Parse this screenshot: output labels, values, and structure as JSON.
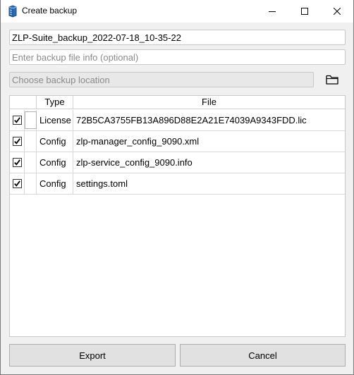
{
  "window": {
    "title": "Create backup",
    "icon": "database-icon"
  },
  "form": {
    "backup_name_value": "ZLP-Suite_backup_2022-07-18_10-35-22",
    "info_placeholder": "Enter backup file info (optional)",
    "location_placeholder": "Choose backup location"
  },
  "table": {
    "columns": [
      "",
      "Type",
      "File"
    ],
    "rows": [
      {
        "checked": true,
        "type": "License",
        "file": "72B5CA3755FB13A896D88E2A21E74039A9343FDD.lic"
      },
      {
        "checked": true,
        "type": "Config",
        "file": "zlp-manager_config_9090.xml"
      },
      {
        "checked": true,
        "type": "Config",
        "file": "zlp-service_config_9090.info"
      },
      {
        "checked": true,
        "type": "Config",
        "file": "settings.toml"
      }
    ]
  },
  "buttons": {
    "export_label": "Export",
    "cancel_label": "Cancel"
  }
}
